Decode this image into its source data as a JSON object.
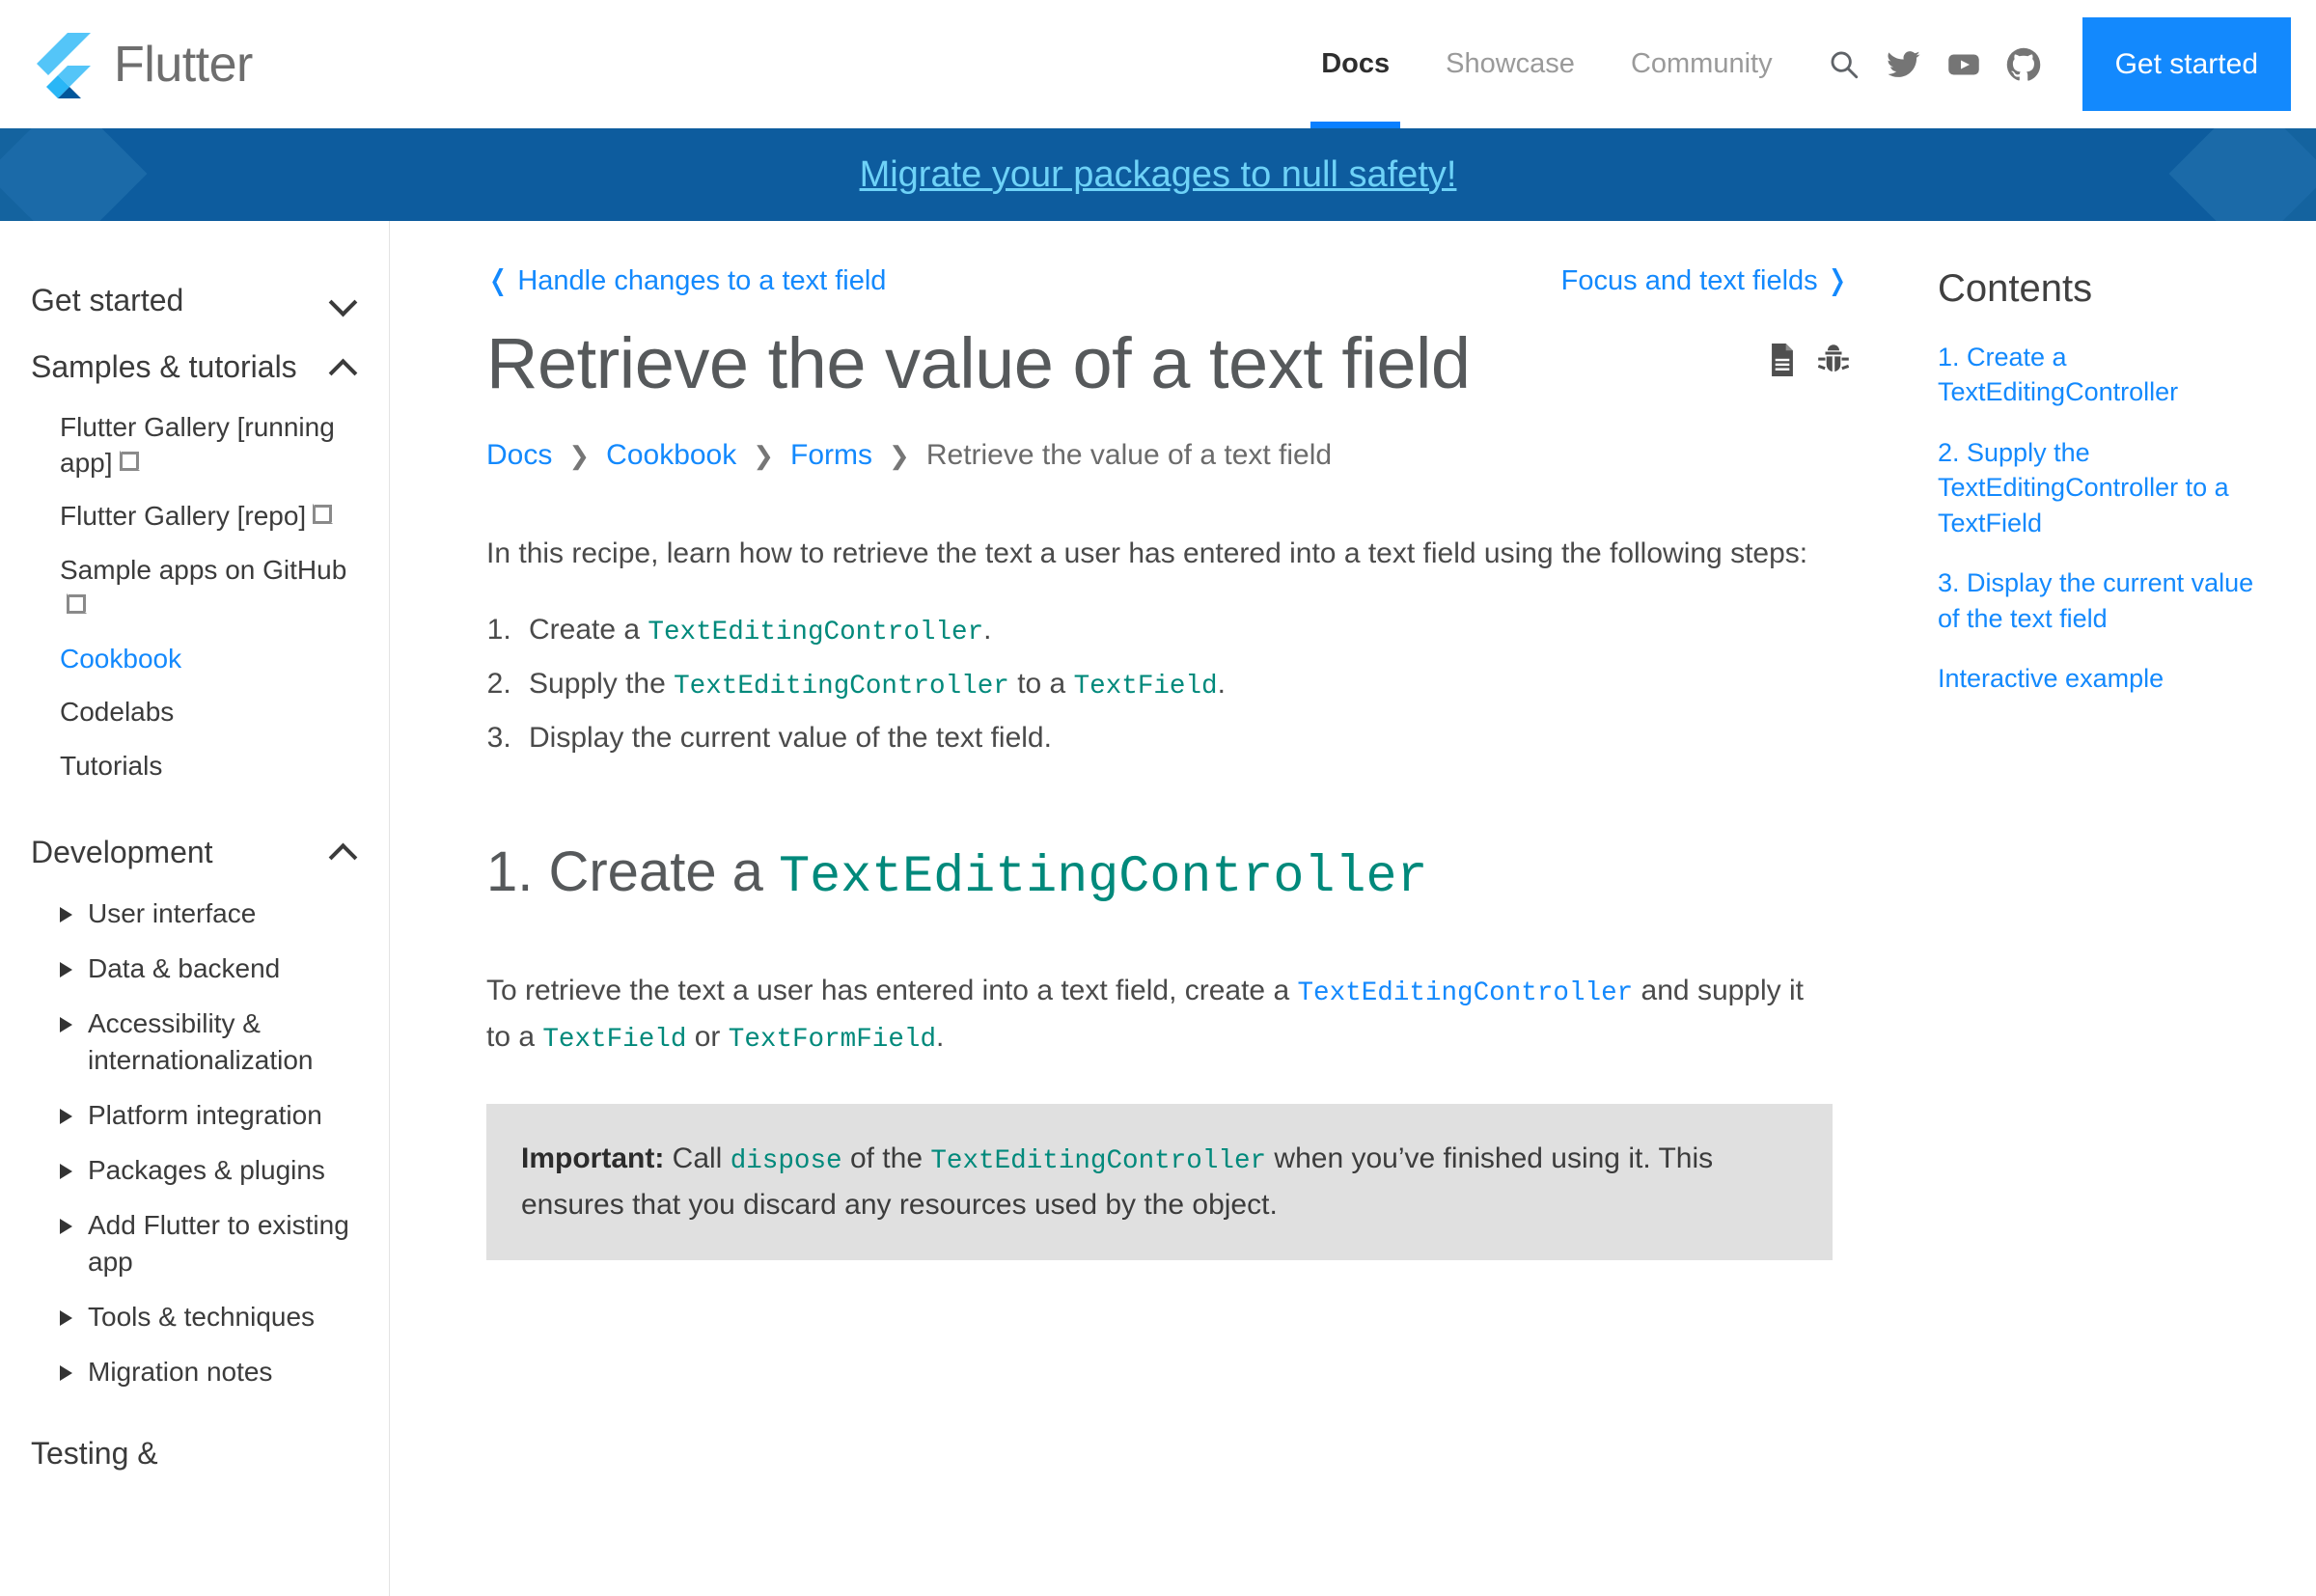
{
  "header": {
    "brand_name": "Flutter",
    "logo_icon": "flutter-logo",
    "nav": [
      {
        "label": "Docs",
        "active": true
      },
      {
        "label": "Showcase",
        "active": false
      },
      {
        "label": "Community",
        "active": false
      }
    ],
    "icons": [
      {
        "name": "search-icon"
      },
      {
        "name": "twitter-icon"
      },
      {
        "name": "youtube-icon"
      },
      {
        "name": "github-icon"
      }
    ],
    "cta_label": "Get started",
    "cta_color": "#1389fd"
  },
  "banner": {
    "text": "Migrate your packages to null safety!",
    "background": "#0d5c9e",
    "text_color": "#6ed2f7"
  },
  "sidebar": {
    "groups": [
      {
        "label": "Get started",
        "state": "collapsed",
        "icon": "chevron-down-icon",
        "items": []
      },
      {
        "label": "Samples & tutorials",
        "state": "expanded",
        "icon": "chevron-up-icon",
        "items": [
          {
            "label": "Flutter Gallery [running app]",
            "external": true,
            "current": false
          },
          {
            "label": "Flutter Gallery [repo]",
            "external": true,
            "current": false
          },
          {
            "label": "Sample apps on GitHub",
            "external": true,
            "current": false
          },
          {
            "label": "Cookbook",
            "external": false,
            "current": true
          },
          {
            "label": "Codelabs",
            "external": false,
            "current": false
          },
          {
            "label": "Tutorials",
            "external": false,
            "current": false
          }
        ]
      },
      {
        "label": "Development",
        "state": "expanded",
        "icon": "chevron-up-icon",
        "items": [
          {
            "label": "User interface",
            "triangle": true
          },
          {
            "label": "Data & backend",
            "triangle": true
          },
          {
            "label": "Accessibility & internationalization",
            "triangle": true
          },
          {
            "label": "Platform integration",
            "triangle": true
          },
          {
            "label": "Packages & plugins",
            "triangle": true
          },
          {
            "label": "Add Flutter to existing app",
            "triangle": true
          },
          {
            "label": "Tools & techniques",
            "triangle": true
          },
          {
            "label": "Migration notes",
            "triangle": true
          }
        ]
      },
      {
        "label": "Testing &",
        "state": "cutoff",
        "items": []
      }
    ]
  },
  "pager": {
    "prev_label": "❬ Handle changes to a text field",
    "next_label": "Focus and text fields ❭"
  },
  "page": {
    "title": "Retrieve the value of a text field",
    "title_icons": [
      {
        "name": "page-source-icon"
      },
      {
        "name": "bug-report-icon"
      }
    ],
    "breadcrumb": [
      {
        "label": "Docs",
        "link": true
      },
      {
        "label": "Cookbook",
        "link": true
      },
      {
        "label": "Forms",
        "link": true
      },
      {
        "label": "Retrieve the value of a text field",
        "link": false
      }
    ],
    "breadcrumb_separator": "❯",
    "intro": "In this recipe, learn how to retrieve the text a user has entered into a text field using the following steps:",
    "steps": [
      {
        "pre": "Create a ",
        "code": "TextEditingController",
        "post": "."
      },
      {
        "pre": "Supply the ",
        "code": "TextEditingController",
        "mid": " to a ",
        "code2": "TextField",
        "post": "."
      },
      {
        "pre": "Display the current value of the text field.",
        "code": "",
        "post": ""
      }
    ],
    "section1": {
      "heading_number": "1. Create a ",
      "heading_code": "TextEditingController",
      "para_1": "To retrieve the text a user has entered into a text field, create a ",
      "para_1_code_link": "TextEditingController",
      "para_1_mid": " and supply it to a ",
      "para_1_code_2": "TextField",
      "para_1_or": " or ",
      "para_1_code_3": "TextFormField",
      "para_1_end": "."
    },
    "callout": {
      "label": "Important:",
      "t1": " Call ",
      "code1": "dispose",
      "t2": " of the ",
      "code2": "TextEditingController",
      "t3": " when you’ve finished using it. This ensures that you discard any resources used by the object."
    }
  },
  "toc": {
    "title": "Contents",
    "links": [
      "1. Create a TextEditingController",
      "2. Supply the TextEditingController to a TextField",
      "3. Display the current value of the text field",
      "Interactive example"
    ]
  },
  "colors": {
    "accent_blue": "#1389fd",
    "code_teal": "#00897b",
    "banner_blue": "#0d5c9e"
  }
}
